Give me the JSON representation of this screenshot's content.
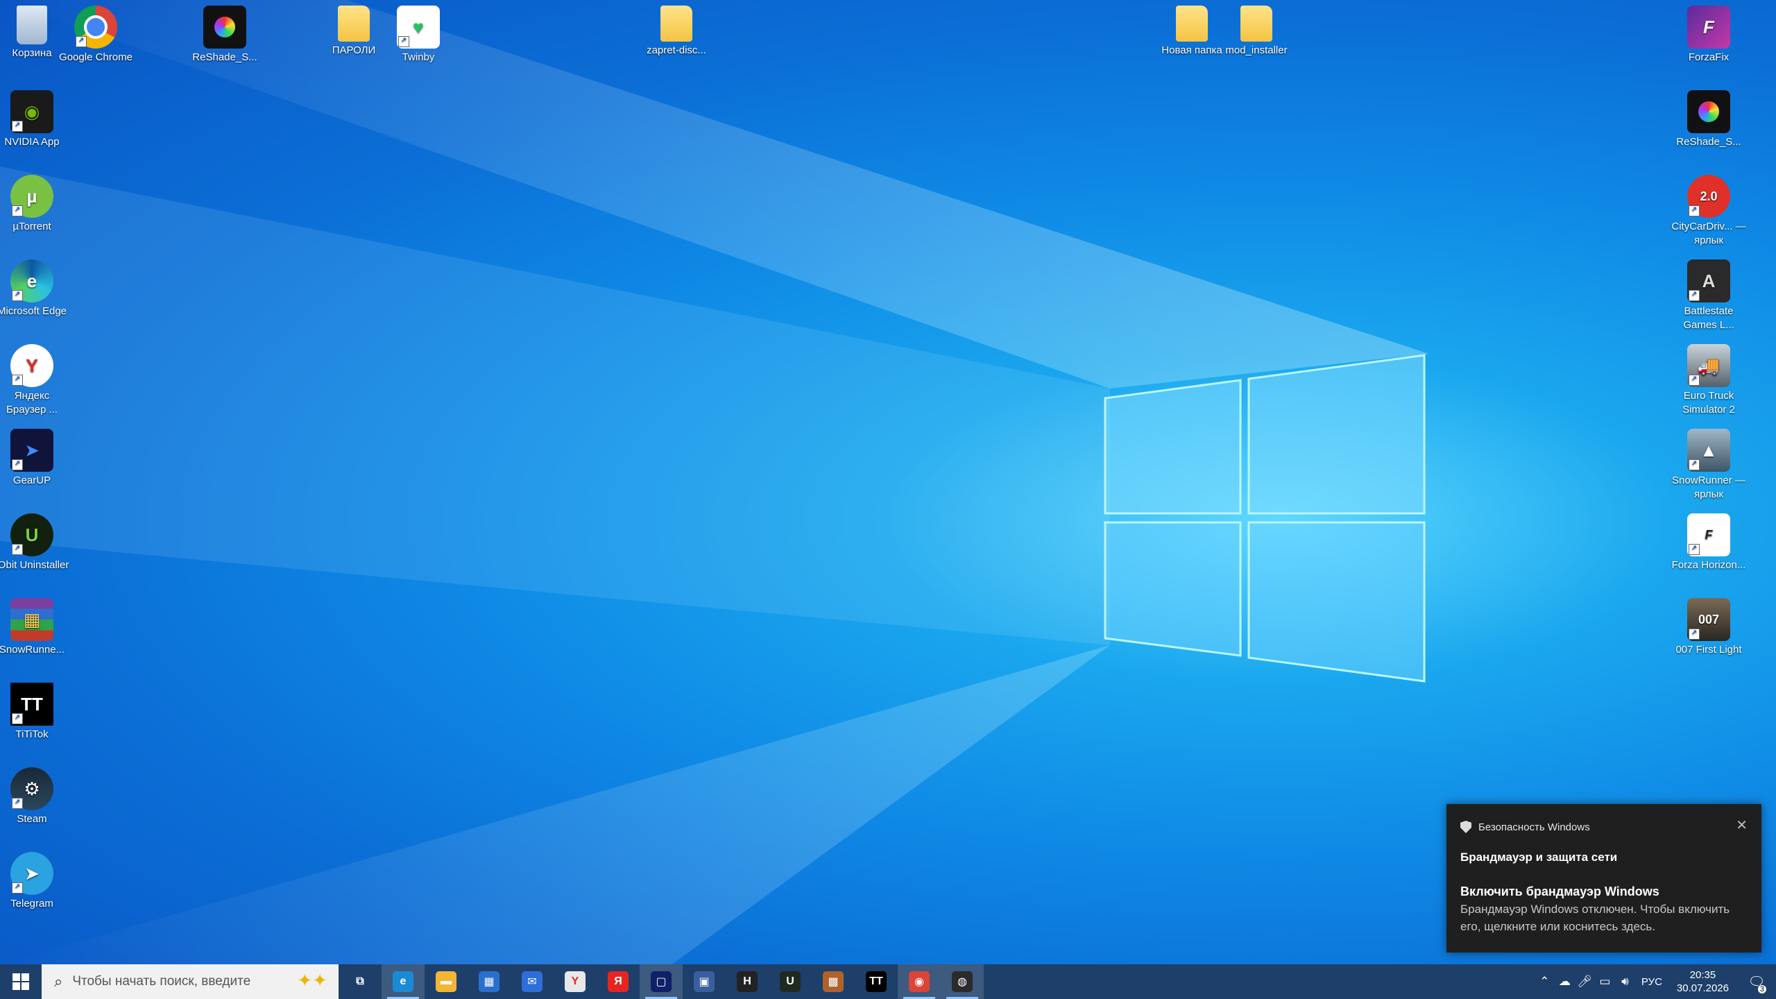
{
  "desktop": {
    "left_column": [
      {
        "label": "Корзина",
        "icon": "recycle-bin-icon"
      },
      {
        "label": "NVIDIA App",
        "icon": "nvidia-icon"
      },
      {
        "label": "µTorrent",
        "icon": "utorrent-icon"
      },
      {
        "label": "Microsoft Edge",
        "icon": "edge-icon"
      },
      {
        "label": "Яндекс Браузер ...",
        "icon": "yandex-browser-icon"
      },
      {
        "label": "GearUP",
        "icon": "gearup-icon"
      },
      {
        "label": "IObit Uninstaller",
        "icon": "iobit-icon"
      },
      {
        "label": "SnowRunne...",
        "icon": "winrar-icon"
      },
      {
        "label": "TiTiTok",
        "icon": "tititok-icon"
      },
      {
        "label": "Steam",
        "icon": "steam-icon"
      },
      {
        "label": "Telegram",
        "icon": "telegram-icon"
      }
    ],
    "top_row": [
      {
        "label": "Google Chrome",
        "icon": "chrome-icon"
      },
      {
        "label": "ReShade_S...",
        "icon": "reshade-icon"
      },
      {
        "label": "ПАРОЛИ",
        "icon": "folder-icon"
      },
      {
        "label": "Twinby",
        "icon": "twinby-icon"
      },
      {
        "label": "zapret-disc...",
        "icon": "folder-icon"
      },
      {
        "label": "Новая папка",
        "icon": "folder-icon"
      },
      {
        "label": "mod_installer",
        "icon": "folder-icon"
      }
    ],
    "right_column": [
      {
        "label": "ForzaFix",
        "icon": "forzafix-icon"
      },
      {
        "label": "ReShade_S...",
        "icon": "reshade-icon"
      },
      {
        "label": "CityCarDriv... — ярлык",
        "icon": "citycardriving-icon"
      },
      {
        "label": "Battlestate Games L...",
        "icon": "battlestate-icon"
      },
      {
        "label": "Euro Truck Simulator 2",
        "icon": "ets2-icon"
      },
      {
        "label": "SnowRunner — ярлык",
        "icon": "snowrunner-icon"
      },
      {
        "label": "Forza Horizon...",
        "icon": "forza-horizon-icon"
      },
      {
        "label": "007 First Light",
        "icon": "007-icon"
      }
    ]
  },
  "toast": {
    "app": "Безопасность Windows",
    "title": "Брандмауэр и защита сети",
    "heading": "Включить брандмауэр Windows",
    "body": "Брандмауэр Windows отключен. Чтобы включить его, щелкните или коснитесь здесь.",
    "close": "✕"
  },
  "taskbar": {
    "search_placeholder": "Чтобы начать поиск, введите",
    "apps": [
      {
        "name": "task-view",
        "glyph": "⧉",
        "color": "#1e3f6a"
      },
      {
        "name": "edge",
        "glyph": "e",
        "color": "#1a8ad4"
      },
      {
        "name": "file-explorer",
        "glyph": "▬",
        "color": "#f2b632"
      },
      {
        "name": "store",
        "glyph": "▦",
        "color": "#2a6fd0"
      },
      {
        "name": "mail",
        "glyph": "✉",
        "color": "#2d6ed8"
      },
      {
        "name": "yandex-browser",
        "glyph": "Y",
        "color": "#e8e8e8"
      },
      {
        "name": "yandex",
        "glyph": "Я",
        "color": "#e52620"
      },
      {
        "name": "app-blue",
        "glyph": "▢",
        "color": "#10206a"
      },
      {
        "name": "remote",
        "glyph": "▣",
        "color": "#3a5fa0"
      },
      {
        "name": "h-app",
        "glyph": "H",
        "color": "#222222"
      },
      {
        "name": "iobit",
        "glyph": "U",
        "color": "#1f2b1f"
      },
      {
        "name": "winrar",
        "glyph": "▩",
        "color": "#b0622a"
      },
      {
        "name": "tititok",
        "glyph": "TT",
        "color": "#000000"
      },
      {
        "name": "chrome",
        "glyph": "◉",
        "color": "#db4437"
      },
      {
        "name": "recorder",
        "glyph": "◍",
        "color": "#2b2b2b"
      }
    ],
    "tray": {
      "lang": "РУС",
      "time": "20:35",
      "date": "30.07.2026",
      "notif_count": "3"
    }
  }
}
